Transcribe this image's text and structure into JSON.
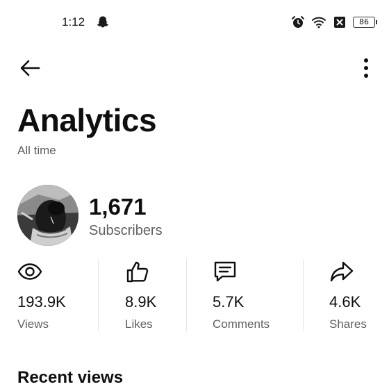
{
  "status_bar": {
    "time": "1:12",
    "battery": "86",
    "icons": [
      "snapchat-ghost-icon",
      "alarm-icon",
      "wifi-icon",
      "notification-x-icon",
      "battery-icon"
    ]
  },
  "header": {
    "back_icon": "arrow-left-icon",
    "more_icon": "more-vertical-icon"
  },
  "page": {
    "title": "Analytics",
    "subtitle": "All time"
  },
  "channel": {
    "subscriber_count": "1,671",
    "subscriber_label": "Subscribers"
  },
  "stats": [
    {
      "icon": "eye-icon",
      "value": "193.9K",
      "label": "Views"
    },
    {
      "icon": "thumbs-up-icon",
      "value": "8.9K",
      "label": "Likes"
    },
    {
      "icon": "comment-icon",
      "value": "5.7K",
      "label": "Comments"
    },
    {
      "icon": "share-icon",
      "value": "4.6K",
      "label": "Shares"
    }
  ],
  "sections": {
    "recent_views": "Recent views"
  },
  "colors": {
    "text_primary": "#0f0f0f",
    "text_secondary": "#606060",
    "divider": "#e5e5e5",
    "background": "#ffffff"
  }
}
